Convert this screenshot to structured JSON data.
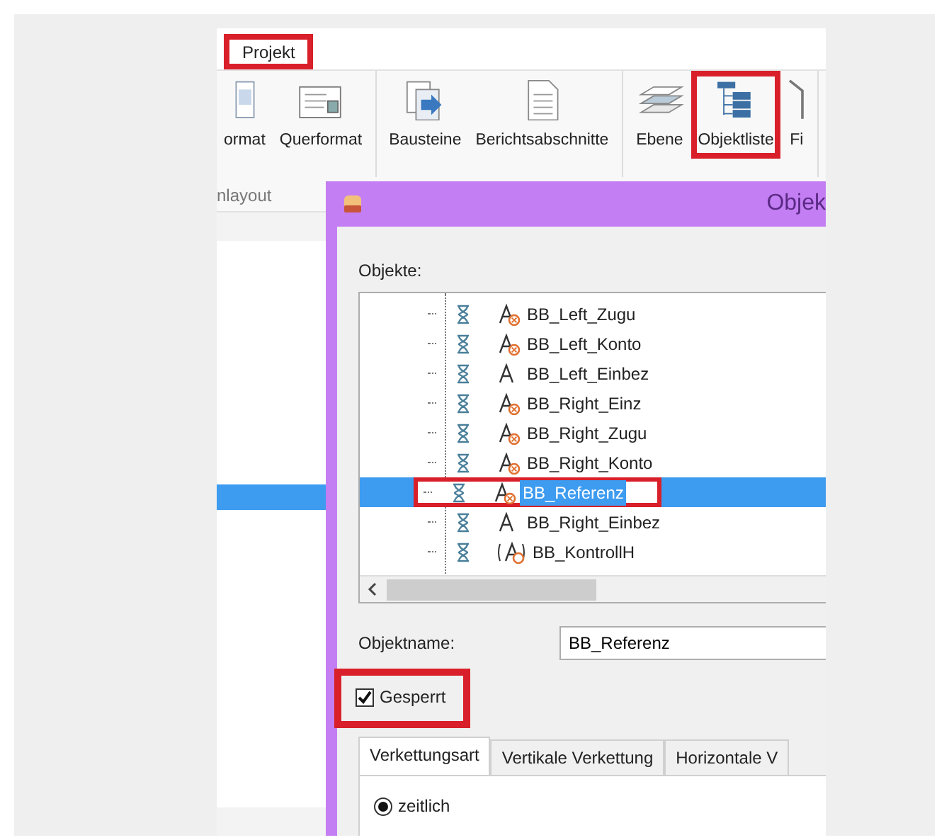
{
  "ribbon": {
    "tabs": [
      {
        "label": "Projekt",
        "highlight": true
      }
    ],
    "groups": [
      {
        "buttons": [
          {
            "label": "ormat",
            "kind": "portrait",
            "highlight": false
          },
          {
            "label": "Querformat",
            "kind": "landscape",
            "highlight": false
          }
        ],
        "label": "nlayout"
      },
      {
        "buttons": [
          {
            "label": "Bausteine",
            "kind": "blocks",
            "highlight": false
          },
          {
            "label": "Berichtsabschnitte",
            "kind": "page",
            "highlight": false
          }
        ]
      },
      {
        "buttons": [
          {
            "label": "Ebene",
            "kind": "layers",
            "highlight": false
          },
          {
            "label": "Objektliste",
            "kind": "tree",
            "highlight": true
          },
          {
            "label": "Fi",
            "kind": "cut",
            "highlight": false
          }
        ]
      }
    ]
  },
  "dialog": {
    "title": "Objek",
    "objects_label": "Objekte:",
    "objects": [
      {
        "name": "BB_Left_Zugu",
        "kind": "text_cond",
        "selected": false,
        "highlight": false
      },
      {
        "name": "BB_Left_Konto",
        "kind": "text_cond",
        "selected": false,
        "highlight": false
      },
      {
        "name": "BB_Left_Einbez",
        "kind": "text",
        "selected": false,
        "highlight": false
      },
      {
        "name": "BB_Right_Einz",
        "kind": "text_cond",
        "selected": false,
        "highlight": false
      },
      {
        "name": "BB_Right_Zugu",
        "kind": "text_cond",
        "selected": false,
        "highlight": false
      },
      {
        "name": "BB_Right_Konto",
        "kind": "text_cond",
        "selected": false,
        "highlight": false
      },
      {
        "name": "BB_Referenz",
        "kind": "text_cond",
        "selected": true,
        "highlight": true
      },
      {
        "name": "BB_Right_Einbez",
        "kind": "text",
        "selected": false,
        "highlight": false
      },
      {
        "name": "BB_KontrollH",
        "kind": "text_group",
        "selected": false,
        "highlight": false
      }
    ],
    "name_label": "Objektname:",
    "name_value": "BB_Referenz",
    "locked": {
      "label": "Gesperrt",
      "checked": true,
      "highlight": true
    },
    "tabs": [
      {
        "label": "Verkettungsart",
        "selected": true
      },
      {
        "label": "Vertikale Verkettung",
        "selected": false
      },
      {
        "label": "Horizontale V",
        "selected": false
      }
    ],
    "options": [
      {
        "label": "zeitlich",
        "selected": true
      }
    ]
  }
}
